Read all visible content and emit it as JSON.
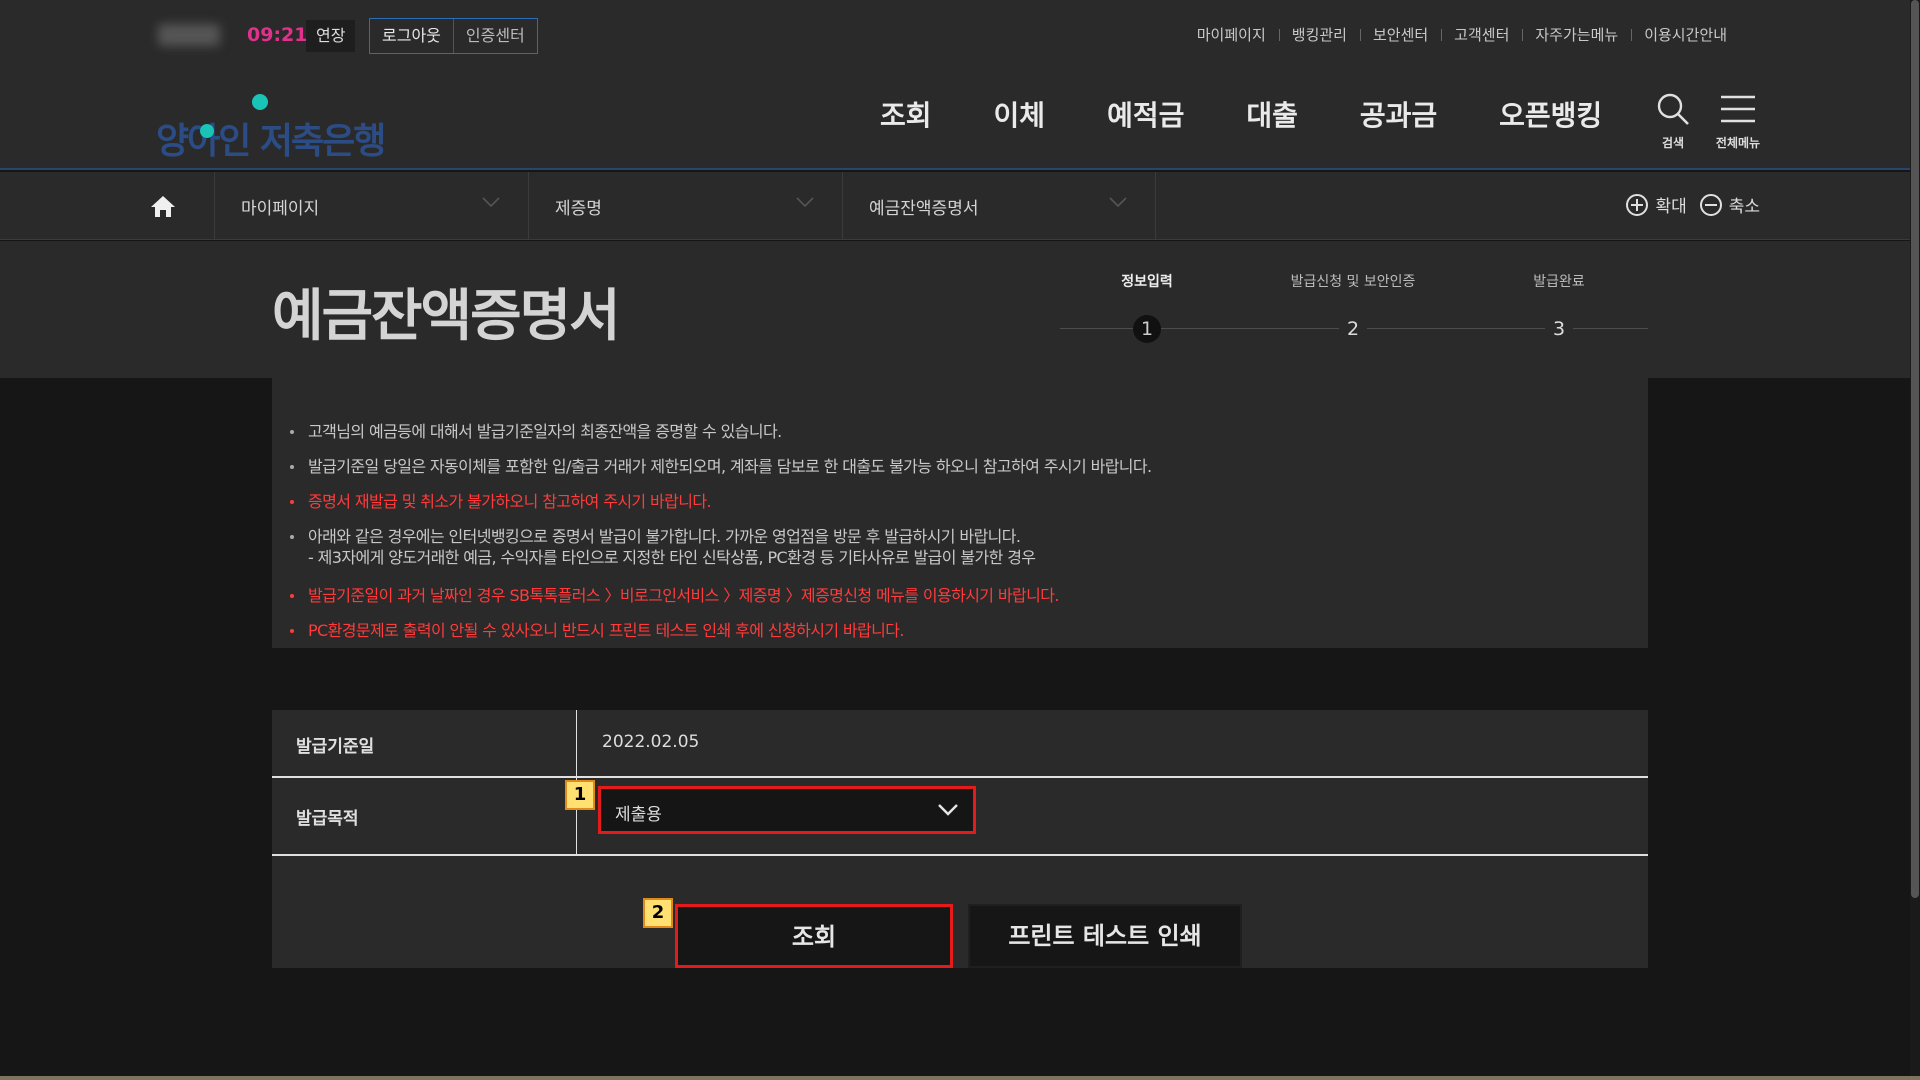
{
  "utility": {
    "time": "09:21",
    "extend_label": "연장",
    "logout_label": "로그아웃",
    "cert_label": "인증센터",
    "links": [
      "마이페이지",
      "뱅킹관리",
      "보안센터",
      "고객센터",
      "자주가는메뉴",
      "이용시간안내"
    ]
  },
  "header": {
    "logo_text": "양아인 저축은행",
    "gnb": [
      "조회",
      "이체",
      "예적금",
      "대출",
      "공과금",
      "오픈뱅킹"
    ],
    "search_label": "검색",
    "menu_label": "전체메뉴"
  },
  "breadcrumb": {
    "items": [
      "마이페이지",
      "제증명",
      "예금잔액증명서"
    ],
    "zoom_in": "확대",
    "zoom_out": "축소"
  },
  "page": {
    "title": "예금잔액증명서",
    "steps": [
      {
        "label": "정보입력",
        "num": "1"
      },
      {
        "label": "발급신청 및 보안인증",
        "num": "2"
      },
      {
        "label": "발급완료",
        "num": "3"
      }
    ]
  },
  "notice": {
    "line1": "고객님의 예금등에 대해서 발급기준일자의 최종잔액을 증명할 수 있습니다.",
    "line2": "발급기준일 당일은 자동이체를 포함한 입/출금 거래가 제한되오며, 계좌를 담보로 한 대출도 불가능 하오니 참고하여 주시기 바랍니다.",
    "line3": "증명서 재발급 및 취소가 불가하오니 참고하여 주시기 바랍니다.",
    "line4": "아래와 같은 경우에는 인터넷뱅킹으로 증명서 발급이 불가합니다. 가까운 영업점을 방문 후 발급하시기 바랍니다.",
    "line4_sub": "- 제3자에게 양도거래한 예금, 수익자를 타인으로 지정한 타인 신탁상품, PC환경 등 기타사유로 발급이 불가한 경우",
    "line5": "발급기준일이 과거 날짜인 경우 SB톡톡플러스 〉비로그인서비스 〉제증명 〉제증명신청 메뉴를 이용하시기 바랍니다.",
    "line6": "PC환경문제로 출력이 안될 수 있사오니 반드시 프린트 테스트 인쇄 후에 신청하시기 바랍니다."
  },
  "form": {
    "date_label": "발급기준일",
    "date_value": "2022.02.05",
    "purpose_label": "발급목적",
    "purpose_value": "제출용",
    "badge1": "1",
    "badge2": "2",
    "search_button": "조회",
    "print_button": "프린트 테스트 인쇄"
  },
  "colors": {
    "accent_red": "#e31b1b",
    "time_color": "#e0328c",
    "logo_dot": "#19c3b6",
    "logo_text": "#2c4c86"
  }
}
